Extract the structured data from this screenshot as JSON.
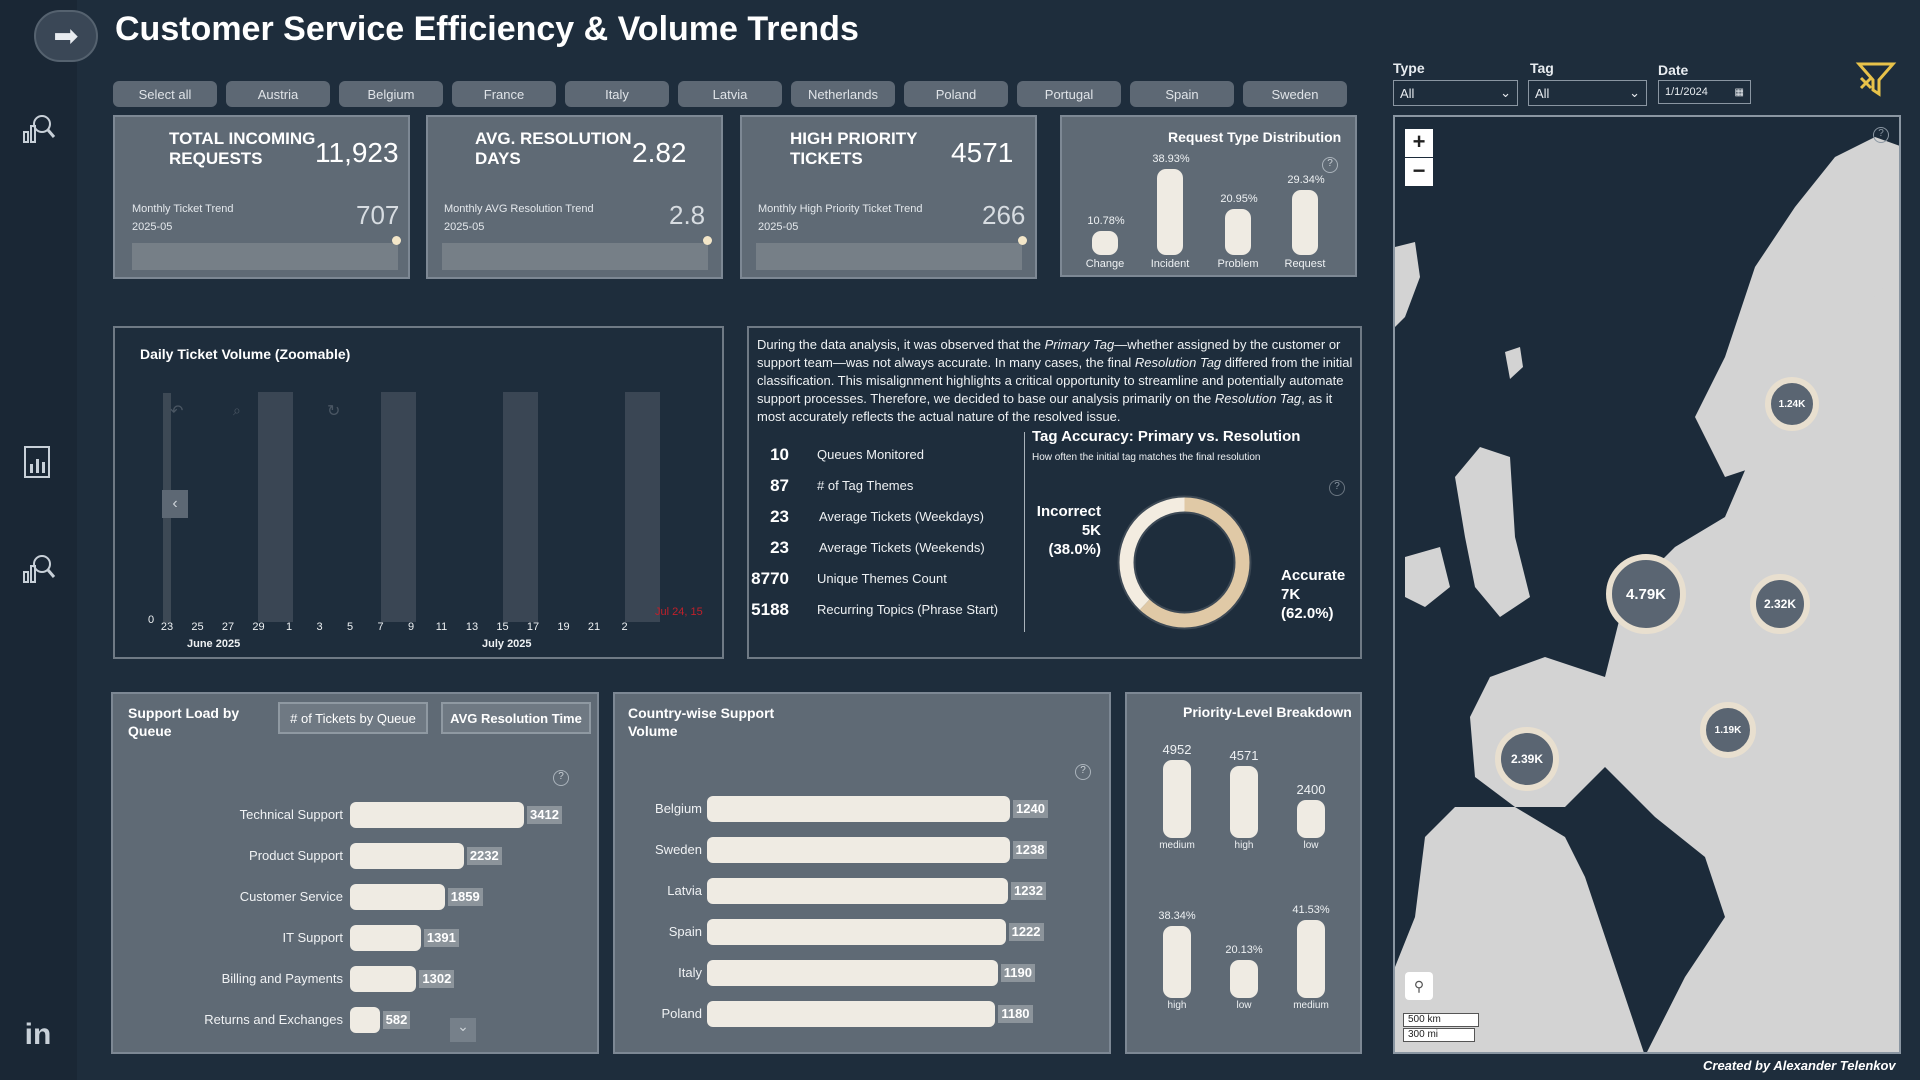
{
  "title": "Customer Service Efficiency & Volume Trends",
  "countries": [
    "Select all",
    "Austria",
    "Belgium",
    "France",
    "Italy",
    "Latvia",
    "Netherlands",
    "Poland",
    "Portugal",
    "Spain",
    "Sweden"
  ],
  "filters": {
    "type": {
      "label": "Type",
      "value": "All"
    },
    "tag": {
      "label": "Tag",
      "value": "All"
    },
    "date": {
      "label": "Date",
      "value": "1/1/2024"
    }
  },
  "kpis": [
    {
      "title_line1": "TOTAL INCOMING",
      "title_line2": "REQUESTS",
      "value": "11,923",
      "trend_label": "Monthly Ticket Trend",
      "period": "2025-05",
      "trend_value": "707"
    },
    {
      "title_line1": "AVG. RESOLUTION",
      "title_line2": "DAYS",
      "value": "2.82",
      "trend_label": "Monthly AVG Resolution Trend",
      "period": "2025-05",
      "trend_value": "2.8"
    },
    {
      "title_line1": "HIGH PRIORITY",
      "title_line2": "TICKETS",
      "value": "4571",
      "trend_label": "Monthly High Priority Ticket Trend",
      "period": "2025-05",
      "trend_value": "266"
    }
  ],
  "request_type": {
    "title": "Request Type Distribution",
    "items": [
      {
        "label": "Change",
        "pct": "10.78%",
        "value": 10.78
      },
      {
        "label": "Incident",
        "pct": "38.93%",
        "value": 38.93
      },
      {
        "label": "Problem",
        "pct": "20.95%",
        "value": 20.95
      },
      {
        "label": "Request",
        "pct": "29.34%",
        "value": 29.34
      }
    ]
  },
  "daily_volume": {
    "title": "Daily Ticket Volume (Zoomable)",
    "y_zero": "0",
    "ticks": [
      "23",
      "25",
      "27",
      "29",
      "1",
      "3",
      "5",
      "7",
      "9",
      "11",
      "13",
      "15",
      "17",
      "19",
      "21",
      "2"
    ],
    "months": [
      "June 2025",
      "July 2025"
    ],
    "marker": "Jul 24, 15"
  },
  "analysis": {
    "p1": "During the data analysis, it was observed that the ",
    "e1": "Primary Tag",
    "p2": "—whether assigned by the customer or support team—was not always accurate. In many cases, the final ",
    "e2": "Resolution Tag",
    "p3": " differed from the initial classification. This misalignment highlights a critical opportunity to streamline and potentially automate support processes. Therefore, we decided to base our analysis primarily on the ",
    "e3": "Resolution Tag",
    "p4": ", as it most accurately reflects the actual nature of the resolved issue."
  },
  "stats": [
    {
      "num": "10",
      "label": "Queues Monitored"
    },
    {
      "num": "87",
      "label": "# of Tag Themes"
    },
    {
      "num": "23",
      "label": "Average Tickets (Weekdays)"
    },
    {
      "num": "23",
      "label": "Average Tickets (Weekends)"
    },
    {
      "num": "8770",
      "label": "Unique Themes Count"
    },
    {
      "num": "5188",
      "label": "Recurring Topics (Phrase Start)"
    }
  ],
  "tag_accuracy": {
    "title": "Tag Accuracy: Primary vs. Resolution",
    "subtitle": "How often the initial tag matches the final resolution",
    "incorrect": {
      "l1": "Incorrect",
      "l2": "5K",
      "l3": "(38.0%)",
      "value": 38.0
    },
    "accurate": {
      "l1": "Accurate",
      "l2": "7K",
      "l3": "(62.0%)",
      "value": 62.0
    }
  },
  "support_load": {
    "title_l1": "Support Load by",
    "title_l2": "Queue",
    "btn1": "# of Tickets by Queue",
    "btn2": "AVG Resolution Time",
    "rows": [
      {
        "label": "Technical Support",
        "value": 3412
      },
      {
        "label": "Product Support",
        "value": 2232
      },
      {
        "label": "Customer Service",
        "value": 1859
      },
      {
        "label": "IT Support",
        "value": 1391
      },
      {
        "label": "Billing and Payments",
        "value": 1302
      },
      {
        "label": "Returns and Exchanges",
        "value": 582
      }
    ]
  },
  "country_volume": {
    "title_l1": "Country-wise Support",
    "title_l2": "Volume",
    "rows": [
      {
        "label": "Belgium",
        "value": 1240
      },
      {
        "label": "Sweden",
        "value": 1238
      },
      {
        "label": "Latvia",
        "value": 1232
      },
      {
        "label": "Spain",
        "value": 1222
      },
      {
        "label": "Italy",
        "value": 1190
      },
      {
        "label": "Poland",
        "value": 1180
      }
    ]
  },
  "priority": {
    "title": "Priority-Level Breakdown",
    "top": [
      {
        "label": "medium",
        "value": 4952
      },
      {
        "label": "high",
        "value": 4571
      },
      {
        "label": "low",
        "value": 2400
      }
    ],
    "bottom": [
      {
        "label": "high",
        "pct": "38.34%",
        "value": 38.34
      },
      {
        "label": "low",
        "pct": "20.13%",
        "value": 20.13
      },
      {
        "label": "medium",
        "pct": "41.53%",
        "value": 41.53
      }
    ]
  },
  "map": {
    "clusters": [
      "1.24K",
      "4.79K",
      "2.32K",
      "2.39K",
      "1.19K"
    ],
    "scale_km": "500 km",
    "scale_mi": "300 mi",
    "zoom_in": "+",
    "zoom_out": "−"
  },
  "credit": "Created by Alexander Telenkov",
  "colors": {
    "bg": "#1e2d3c",
    "card": "#5f6a75",
    "bar": "#efebe3",
    "accent": "#e8c24a"
  }
}
